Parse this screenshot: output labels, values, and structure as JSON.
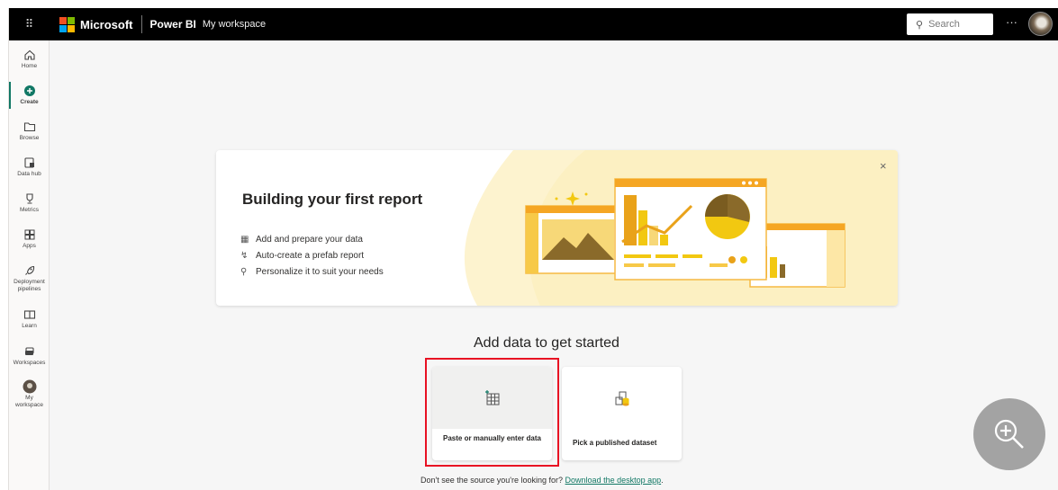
{
  "topbar": {
    "waffle_glyph": "⠿",
    "brand": "Microsoft",
    "app_name": "Power BI",
    "workspace_name": "My workspace",
    "search_placeholder": "Search",
    "more_glyph": "···"
  },
  "nav": {
    "items": [
      {
        "label": "Home",
        "icon": "home-icon"
      },
      {
        "label": "Create",
        "icon": "plus-circle-icon",
        "active": true
      },
      {
        "label": "Browse",
        "icon": "folder-icon"
      },
      {
        "label": "Data hub",
        "icon": "data-hub-icon"
      },
      {
        "label": "Metrics",
        "icon": "trophy-icon"
      },
      {
        "label": "Apps",
        "icon": "apps-icon"
      },
      {
        "label": "Deployment pipelines",
        "icon": "rocket-icon"
      },
      {
        "label": "Learn",
        "icon": "book-icon"
      },
      {
        "label": "Workspaces",
        "icon": "workspaces-icon"
      },
      {
        "label": "My workspace",
        "icon": "avatar-icon"
      }
    ],
    "accent_color": "#117865"
  },
  "hero": {
    "title": "Building your first report",
    "bullets": [
      {
        "text": "Add and prepare your data",
        "icon": "table-icon"
      },
      {
        "text": "Auto-create a prefab report",
        "icon": "lightning-icon"
      },
      {
        "text": "Personalize it to suit your needs",
        "icon": "trophy-icon"
      }
    ],
    "close_glyph": "×"
  },
  "add_data": {
    "title": "Add data to get started",
    "tiles": [
      {
        "label": "Paste or manually enter data",
        "icon": "table-add-icon",
        "highlighted": true
      },
      {
        "label": "Pick a published dataset",
        "icon": "dataset-icon"
      }
    ]
  },
  "footer": {
    "question": "Don't see the source you're looking for?",
    "link": "Download the desktop app",
    "trailing": "."
  },
  "colors": {
    "topbar_bg": "#000000",
    "accent": "#117865",
    "highlight": "#e81123",
    "illustration_yellow": "#f2c811",
    "illustration_orange": "#f5a623"
  }
}
